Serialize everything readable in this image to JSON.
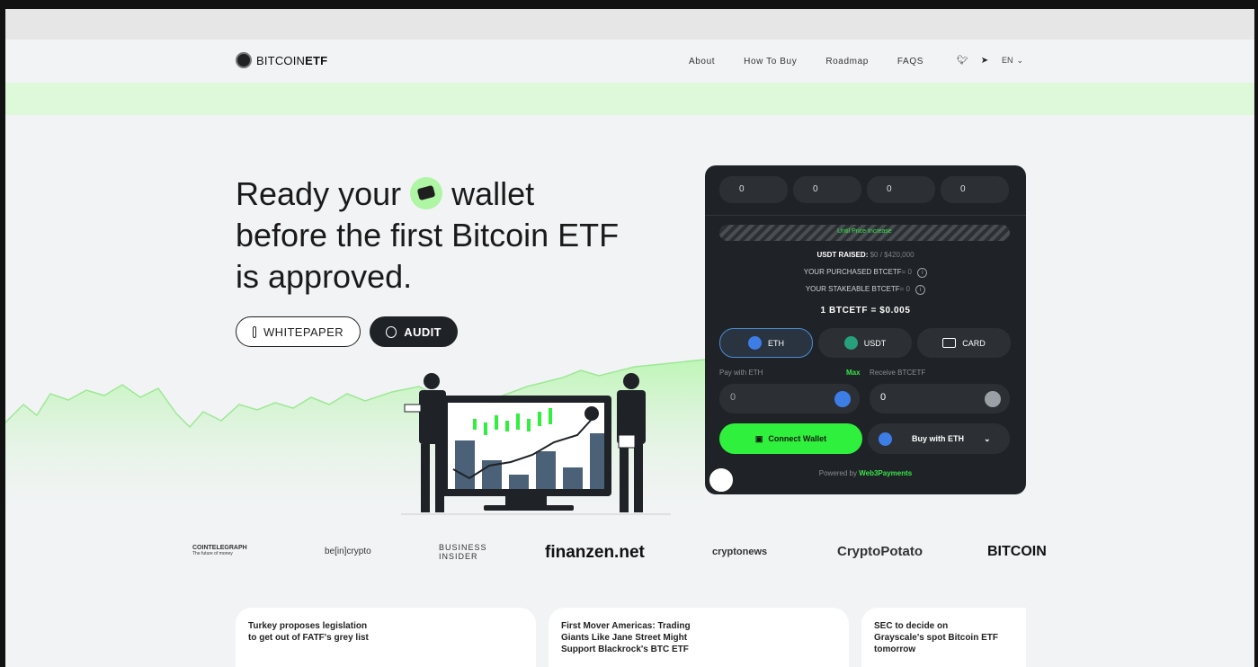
{
  "nav": {
    "brand_plain": "BITCOIN",
    "brand_bold": "ETF",
    "links": [
      "About",
      "How To Buy",
      "Roadmap",
      "FAQS"
    ],
    "twitter_icon": "twitter-icon",
    "telegram_icon": "telegram-icon",
    "language": "EN"
  },
  "hero": {
    "headline_part1": "Ready your",
    "headline_part2": "wallet before the first Bitcoin ETF is approved.",
    "wallet_icon": "wallet-icon",
    "whitepaper_label": "WHITEPAPER",
    "audit_label": "AUDIT"
  },
  "widget": {
    "countdown": [
      "0",
      "0",
      "0",
      "0"
    ],
    "progress_label": "Until Price Increase",
    "usdt_raised_label": "USDT RAISED:",
    "usdt_raised_value": "$0 / $420,000",
    "purchased_label": "YOUR PURCHASED BTCETF",
    "purchased_value": "= 0",
    "stakeable_label": "YOUR STAKEABLE BTCETF",
    "stakeable_value": "= 0",
    "price": "1 BTCETF = $0.005",
    "pay_tabs": [
      {
        "label": "ETH",
        "icon": "eth-icon"
      },
      {
        "label": "USDT",
        "icon": "usdt-icon"
      },
      {
        "label": "CARD",
        "icon": "card-icon"
      }
    ],
    "pay_with_label": "Pay with ETH",
    "max_label": "Max",
    "receive_label": "Receive BTCETF",
    "pay_placeholder": "0",
    "receive_value": "0",
    "connect_label": "Connect Wallet",
    "buy_label": "Buy with ETH",
    "powered_by": "Powered by",
    "powered_brand": "Web3Payments"
  },
  "press": [
    "COINTELEGRAPH",
    "be[in]crypto",
    "BUSINESS INSIDER",
    "finanzen.net",
    "cryptonews",
    "CryptoPotato",
    "BITCOIN"
  ],
  "press_tagline": "The future of money",
  "news": [
    "Turkey proposes legislation to get out of FATF's grey list",
    "First Mover Americas: Trading Giants Like Jane Street Might Support Blackrock's BTC ETF",
    "SEC to decide on Grayscale's spot Bitcoin ETF tomorrow"
  ],
  "colors": {
    "accent_green": "#2ff03c",
    "widget_bg": "#1f2226",
    "band_green": "#ddf9d9"
  }
}
